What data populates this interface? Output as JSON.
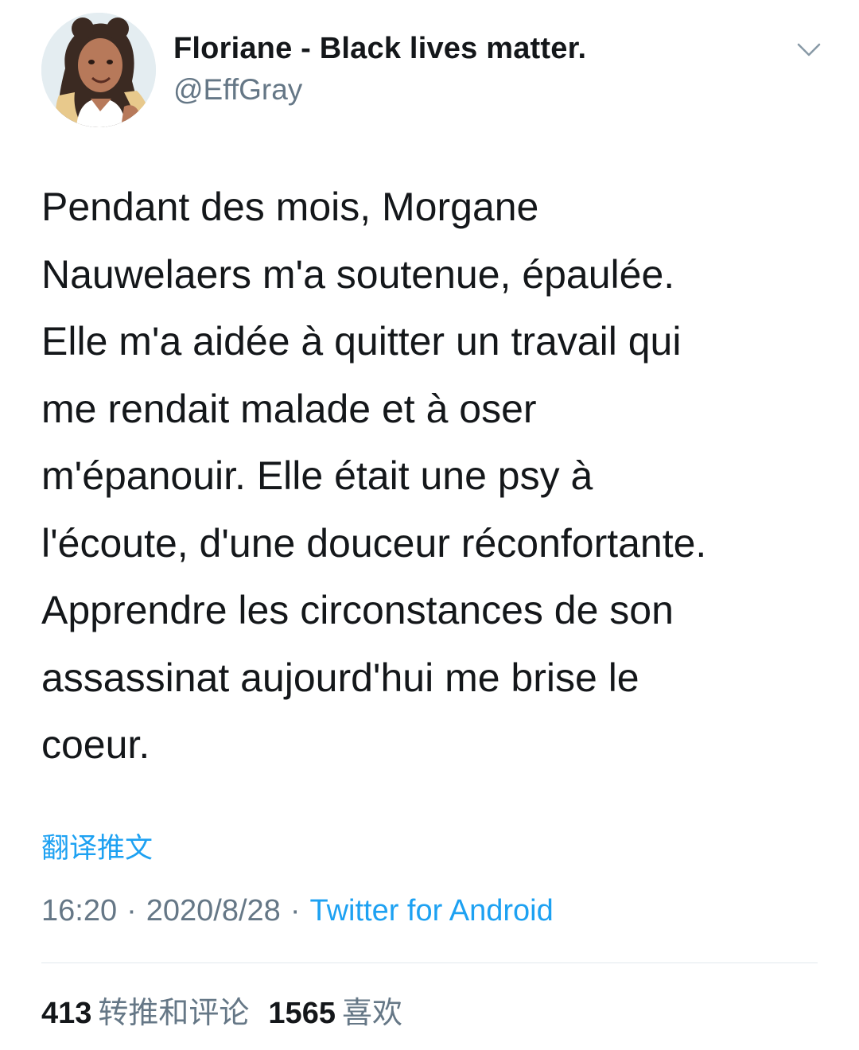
{
  "user": {
    "display_name": "Floriane - Black lives matter.",
    "handle": "@EffGray",
    "avatar_icon": "avatar-illustration",
    "menu_icon": "chevron-down-icon"
  },
  "tweet": {
    "lines": [
      "Pendant des mois, Morgane",
      "Nauwelaers m'a soutenue, épaulée.",
      "Elle m'a aidée à quitter un travail qui",
      "me rendait malade et à oser",
      "m'épanouir. Elle était une psy à",
      "l'écoute, d'une douceur réconfortante.",
      "Apprendre les circonstances de son",
      "assassinat aujourd'hui me brise le",
      "coeur."
    ],
    "translate_label": "翻译推文"
  },
  "meta": {
    "time": "16:20",
    "separator": "·",
    "date": "2020/8/28",
    "source": "Twitter for Android"
  },
  "stats": {
    "retweets_count": "413",
    "retweets_label": "转推和评论",
    "likes_count": "1565",
    "likes_label": "喜欢"
  },
  "colors": {
    "accent": "#1da1f2",
    "secondary_text": "#657786",
    "primary_text": "#14171a",
    "divider": "#e1e8ed"
  }
}
